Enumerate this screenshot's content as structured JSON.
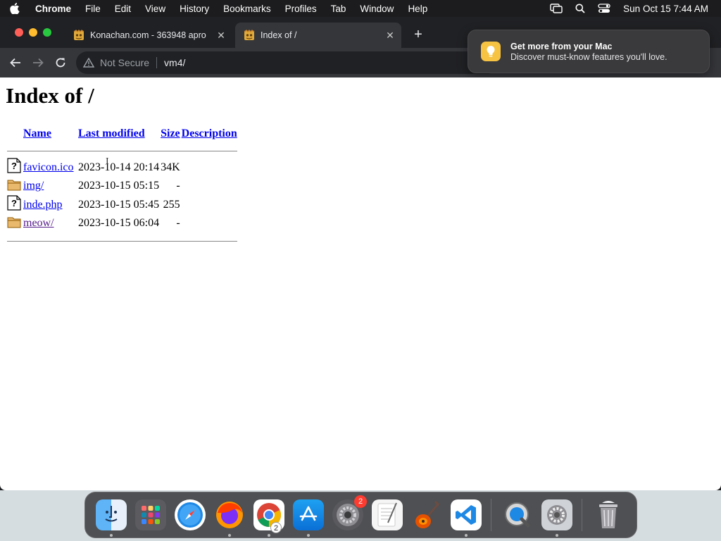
{
  "menubar": {
    "app_name": "Chrome",
    "items": [
      "File",
      "Edit",
      "View",
      "History",
      "Bookmarks",
      "Profiles",
      "Tab",
      "Window",
      "Help"
    ],
    "clock": "Sun Oct 15  7:44 AM",
    "status_icons": [
      "screen-mirroring-icon",
      "spotlight-search-icon",
      "control-center-icon"
    ]
  },
  "browser": {
    "tabs": [
      {
        "title": "Konachan.com - 363948 apro",
        "favicon": "konachan-favicon",
        "active": false
      },
      {
        "title": "Index of /",
        "favicon": "konachan-favicon",
        "active": true
      }
    ],
    "new_tab_symbol": "+",
    "security_label": "Not Secure",
    "url": "vm4/"
  },
  "notification": {
    "title": "Get more from your Mac",
    "body": "Discover must-know features you'll love.",
    "icon": "lightbulb-icon"
  },
  "page": {
    "heading": "Index of /",
    "columns": [
      "Name",
      "Last modified",
      "Size",
      "Description"
    ],
    "rows": [
      {
        "name": "favicon.ico",
        "modified": "2023-10-14 20:14",
        "size": "34K",
        "description": "",
        "icon": "unknown-file-icon",
        "visited": false
      },
      {
        "name": "img/",
        "modified": "2023-10-15 05:15",
        "size": "-",
        "description": "",
        "icon": "folder-icon",
        "visited": false
      },
      {
        "name": "inde.php",
        "modified": "2023-10-15 05:45",
        "size": "255",
        "description": "",
        "icon": "unknown-file-icon",
        "visited": false
      },
      {
        "name": "meow/",
        "modified": "2023-10-15 06:04",
        "size": "-",
        "description": "",
        "icon": "folder-icon",
        "visited": true
      }
    ]
  },
  "dock": {
    "apps": [
      {
        "name": "finder",
        "running": true,
        "badge": ""
      },
      {
        "name": "launchpad",
        "running": false,
        "badge": ""
      },
      {
        "name": "safari",
        "running": false,
        "badge": ""
      },
      {
        "name": "firefox",
        "running": true,
        "badge": ""
      },
      {
        "name": "chrome",
        "running": true,
        "badge": "2"
      },
      {
        "name": "app-store",
        "running": true,
        "badge": ""
      },
      {
        "name": "system-settings",
        "running": false,
        "badge": "2"
      },
      {
        "name": "textedit",
        "running": false,
        "badge": ""
      },
      {
        "name": "garageband",
        "running": false,
        "badge": ""
      },
      {
        "name": "vscode",
        "running": true,
        "badge": ""
      },
      {
        "name": "quicktime",
        "running": false,
        "badge": ""
      },
      {
        "name": "system-preferences",
        "running": true,
        "badge": ""
      },
      {
        "name": "trash",
        "running": false,
        "badge": ""
      }
    ]
  },
  "colors": {
    "link": "#0000ee",
    "visited_link": "#551a8b",
    "badge": "#ff3b30",
    "notif_icon": "#f6c343"
  }
}
